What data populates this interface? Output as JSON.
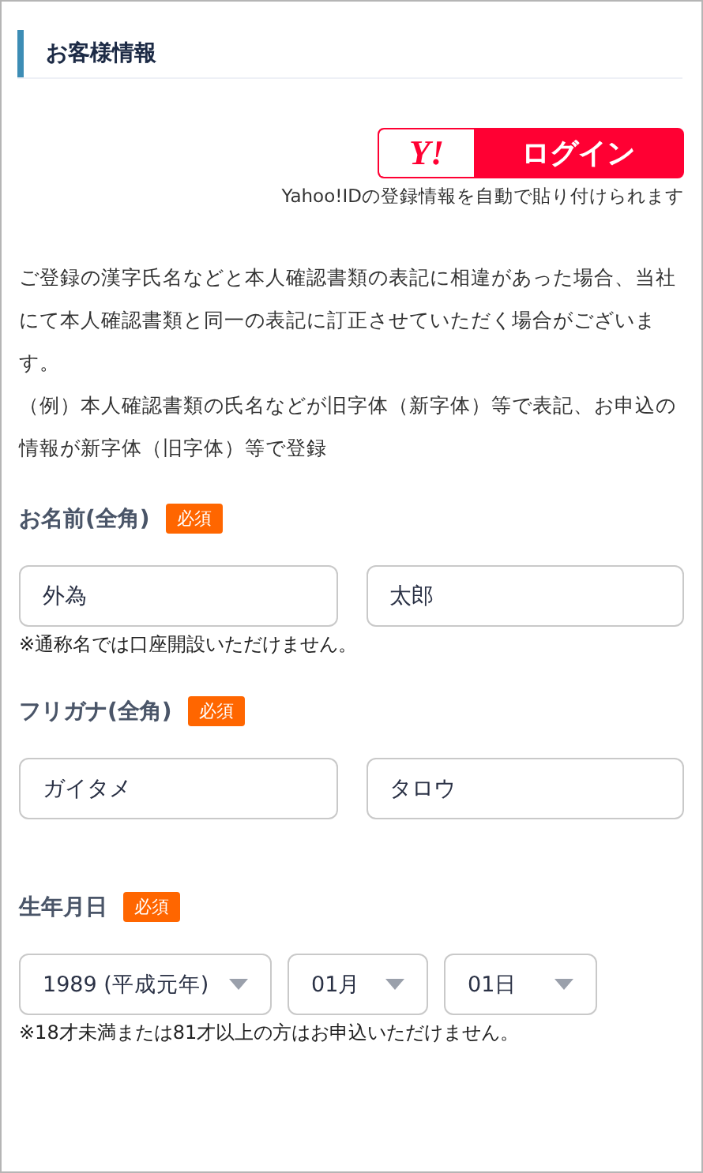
{
  "section": {
    "title": "お客様情報"
  },
  "login": {
    "logo": "Y!",
    "label": "ログイン",
    "note": "Yahoo!IDの登録情報を自動で貼り付けられます"
  },
  "notice": [
    "ご登録の漢字氏名などと本人確認書類の表記に相違があった場合、当社にて本人確認書類と同一の表記に訂正させていただく場合がございます。",
    "（例）本人確認書類の氏名などが旧字体（新字体）等で表記、お申込の情報が新字体（旧字体）等で登録"
  ],
  "fields": [
    {
      "kind": "text",
      "label": "お名前(全角)",
      "badge": "必須",
      "inputs": [
        {
          "value": "外為"
        },
        {
          "value": "太郎"
        }
      ],
      "note": "※通称名では口座開設いただけません。"
    },
    {
      "kind": "text",
      "label": "フリガナ(全角)",
      "badge": "必須",
      "inputs": [
        {
          "value": "ガイタメ"
        },
        {
          "value": "タロウ"
        }
      ]
    },
    {
      "kind": "select",
      "label": "生年月日",
      "badge": "必須",
      "inputs": [
        {
          "value": "1989 (平成元年)"
        },
        {
          "value": "01月"
        },
        {
          "value": "01日"
        }
      ],
      "note": "※18才未満または81才以上の方はお申込いただけません。"
    }
  ]
}
